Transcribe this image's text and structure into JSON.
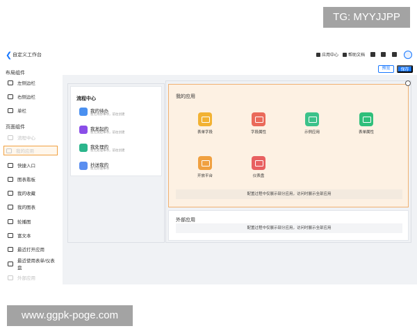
{
  "watermarks": {
    "top": "TG: MYYJJPP",
    "bottom": "www.ggpk-poge.com"
  },
  "header": {
    "back_icon": "chevron-left-icon",
    "title": "自定义工作台",
    "links": {
      "app_center": "应用中心",
      "help_docs": "帮助文档"
    },
    "preview_label": "预览",
    "save_label": "保存"
  },
  "sidebar": {
    "layout_section": "布局组件",
    "layout_items": [
      {
        "label": "左侧边栏"
      },
      {
        "label": "右侧边栏"
      },
      {
        "label": "单栏"
      }
    ],
    "page_section": "页面组件",
    "page_items": [
      {
        "label": "流程中心",
        "state": "disabled"
      },
      {
        "label": "我的应用",
        "state": "active"
      },
      {
        "label": "快捷入口"
      },
      {
        "label": "图表看板"
      },
      {
        "label": "我的收藏"
      },
      {
        "label": "我的图表"
      },
      {
        "label": "轮播图"
      },
      {
        "label": "富文本"
      },
      {
        "label": "最近打开应用"
      },
      {
        "label": "最近使用表单/仪表盘"
      },
      {
        "label": "外部应用",
        "state": "disabled"
      }
    ]
  },
  "flow": {
    "title": "流程中心",
    "items": [
      {
        "name": "我的待办",
        "sub": "暂无待办事项，前往创建",
        "color": "#4a90f0"
      },
      {
        "name": "我发起的",
        "sub": "暂无发起事项，前往创建",
        "color": "#8a4ee8"
      },
      {
        "name": "我处理的",
        "sub": "暂无处理事项，前往创建",
        "color": "#2bb58c"
      },
      {
        "name": "抄送我的",
        "sub": "暂无抄送事项",
        "color": "#5a8ef0"
      }
    ]
  },
  "apps": {
    "title": "我的应用",
    "items": [
      {
        "label": "表单字段",
        "color": "#f2b233"
      },
      {
        "label": "字段属性",
        "color": "#ea6a5a"
      },
      {
        "label": "示例应用",
        "color": "#3cc28a"
      },
      {
        "label": "表单属性",
        "color": "#2fbf7a"
      },
      {
        "label": "开放平台",
        "color": "#f0a040"
      },
      {
        "label": "仪表盘",
        "color": "#e86060"
      }
    ],
    "note": "配置过程中仅展示部分应用，访问时展示全部应用"
  },
  "external": {
    "title": "外部应用",
    "note": "配置过程中仅展示部分应用，访问时展示全部应用"
  },
  "colors": {
    "accent": "#1677ff",
    "highlight_border": "#f0b070",
    "highlight_bg": "#fdf1e3"
  }
}
